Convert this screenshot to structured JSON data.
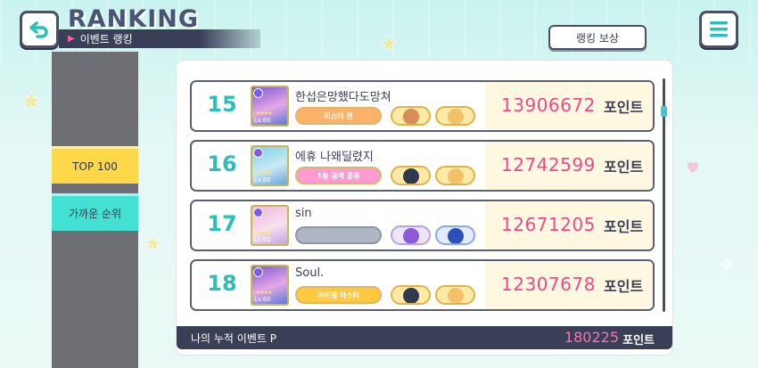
{
  "header": {
    "title": "RANKING",
    "subtitle": "이벤트 랭킹",
    "reward_button": "랭킹 보상"
  },
  "sidebar": {
    "tabs": [
      {
        "label": "TOP 100"
      },
      {
        "label": "가까운 순위"
      }
    ]
  },
  "rows": [
    {
      "rank": "15",
      "name": "한섭은망했다도망쳐",
      "badge": "미스터 전",
      "score": "13906672",
      "unit": "포인트",
      "level": "Lv.60"
    },
    {
      "rank": "16",
      "name": "에휴 나왜딜렸지",
      "badge": "1등 공격 종류",
      "score": "12742599",
      "unit": "포인트",
      "level": "Lv.60"
    },
    {
      "rank": "17",
      "name": "sin",
      "badge": "",
      "score": "12671205",
      "unit": "포인트",
      "level": "Lv.60"
    },
    {
      "rank": "18",
      "name": "Soul.",
      "badge": "아이템 마스터",
      "score": "12307678",
      "unit": "포인트",
      "level": "Lv.60"
    }
  ],
  "footer": {
    "label": "나의 누적 이벤트 P",
    "total": "180225",
    "unit": "포인트"
  },
  "colors": {
    "rank": "#2bbfb9",
    "score": "#f0488a",
    "dark": "#3a3f58",
    "yellow_tab": "#ffd84a",
    "cyan_tab": "#43e0d4"
  },
  "icons": {
    "back": "back-arrow-icon",
    "menu": "hamburger-menu-icon"
  }
}
